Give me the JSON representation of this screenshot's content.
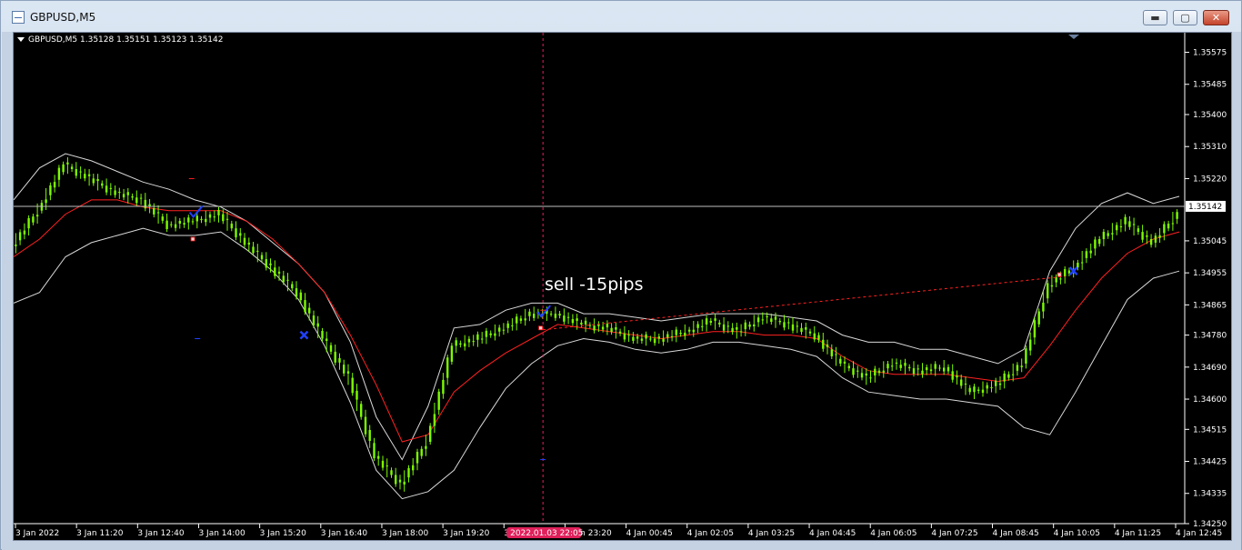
{
  "window": {
    "title": "GBPUSD,M5",
    "minimize_label": "▬",
    "maximize_label": "▢",
    "close_label": "✕"
  },
  "chart": {
    "symbol_info": "GBPUSD,M5  1.35128 1.35151 1.35123 1.35142",
    "annotation": "sell -15pips",
    "current_price_label": "1.35142",
    "cursor_time_label": "2022.01.03 22:05",
    "price_ticks": [
      "1.35575",
      "1.35485",
      "1.35400",
      "1.35310",
      "1.35220",
      "1.35045",
      "1.34955",
      "1.34865",
      "1.34780",
      "1.34690",
      "1.34600",
      "1.34515",
      "1.34425",
      "1.34335",
      "1.34250"
    ],
    "time_ticks": [
      "3 Jan 2022",
      "3 Jan 11:20",
      "3 Jan 12:40",
      "3 Jan 14:00",
      "3 Jan 15:20",
      "3 Jan 16:40",
      "3 Jan 18:00",
      "3 Jan 19:20",
      "3 Jan 2",
      "3 Jan 23:20",
      "4 Jan 00:45",
      "4 Jan 02:05",
      "4 Jan 03:25",
      "4 Jan 04:45",
      "4 Jan 06:05",
      "4 Jan 07:25",
      "4 Jan 08:45",
      "4 Jan 10:05",
      "4 Jan 11:25",
      "4 Jan 12:45"
    ],
    "colors": {
      "background": "#000000",
      "candles": "#7cfc00",
      "moving_average": "#ff2020",
      "bands": "#d8d8d8",
      "cursor_line": "#e0205a",
      "signal_check": "#2040ff",
      "signal_cross": "#2040ff"
    }
  },
  "chart_data": {
    "type": "line",
    "title": "GBPUSD,M5",
    "ylim": [
      1.3425,
      1.3563
    ],
    "series": [
      {
        "values": [
          1.3503,
          1.3513,
          1.3526,
          1.3522,
          1.3518,
          1.3516,
          1.3509,
          1.351,
          1.3512,
          1.3504,
          1.3497,
          1.349,
          1.3477,
          1.3466,
          1.3444,
          1.3436,
          1.3448,
          1.3475,
          1.3477,
          1.348,
          1.3484,
          1.3484,
          1.3481,
          1.348,
          1.3477,
          1.3477,
          1.3479,
          1.3482,
          1.3479,
          1.3483,
          1.3481,
          1.3478,
          1.347,
          1.3466,
          1.347,
          1.3468,
          1.3469,
          1.3462,
          1.3464,
          1.347,
          1.3492,
          1.3497,
          1.3505,
          1.351,
          1.3504,
          1.3512
        ]
      },
      {
        "values": [
          1.35,
          1.3505,
          1.3512,
          1.3516,
          1.3516,
          1.3514,
          1.3513,
          1.3513,
          1.3513,
          1.351,
          1.3505,
          1.3498,
          1.349,
          1.3478,
          1.3464,
          1.3448,
          1.345,
          1.3462,
          1.3468,
          1.3473,
          1.3477,
          1.3481,
          1.348,
          1.3479,
          1.3478,
          1.3477,
          1.3478,
          1.3479,
          1.3479,
          1.3478,
          1.3478,
          1.3477,
          1.3472,
          1.3468,
          1.3467,
          1.3467,
          1.3467,
          1.3466,
          1.3465,
          1.3466,
          1.3475,
          1.3485,
          1.3494,
          1.3501,
          1.3505,
          1.3507
        ]
      },
      {
        "values": [
          1.3516,
          1.3525,
          1.3529,
          1.3527,
          1.3524,
          1.3521,
          1.3519,
          1.3516,
          1.3514,
          1.351,
          1.3504,
          1.3498,
          1.349,
          1.3476,
          1.3455,
          1.3443,
          1.3458,
          1.348,
          1.3481,
          1.3485,
          1.3487,
          1.3487,
          1.3484,
          1.3484,
          1.3483,
          1.3482,
          1.3483,
          1.3484,
          1.3484,
          1.3484,
          1.3483,
          1.3482,
          1.3478,
          1.3476,
          1.3476,
          1.3474,
          1.3474,
          1.3472,
          1.347,
          1.3474,
          1.3496,
          1.3508,
          1.3515,
          1.3518,
          1.3515,
          1.3517
        ]
      },
      {
        "values": [
          1.3487,
          1.349,
          1.35,
          1.3504,
          1.3506,
          1.3508,
          1.3506,
          1.3506,
          1.3507,
          1.3502,
          1.3496,
          1.3488,
          1.3475,
          1.3459,
          1.344,
          1.3432,
          1.3434,
          1.344,
          1.3452,
          1.3463,
          1.347,
          1.3475,
          1.3477,
          1.3476,
          1.3474,
          1.3473,
          1.3474,
          1.3476,
          1.3476,
          1.3475,
          1.3474,
          1.3472,
          1.3466,
          1.3462,
          1.3461,
          1.346,
          1.346,
          1.3459,
          1.3458,
          1.3452,
          1.345,
          1.3462,
          1.3475,
          1.3488,
          1.3494,
          1.3496
        ]
      }
    ]
  }
}
